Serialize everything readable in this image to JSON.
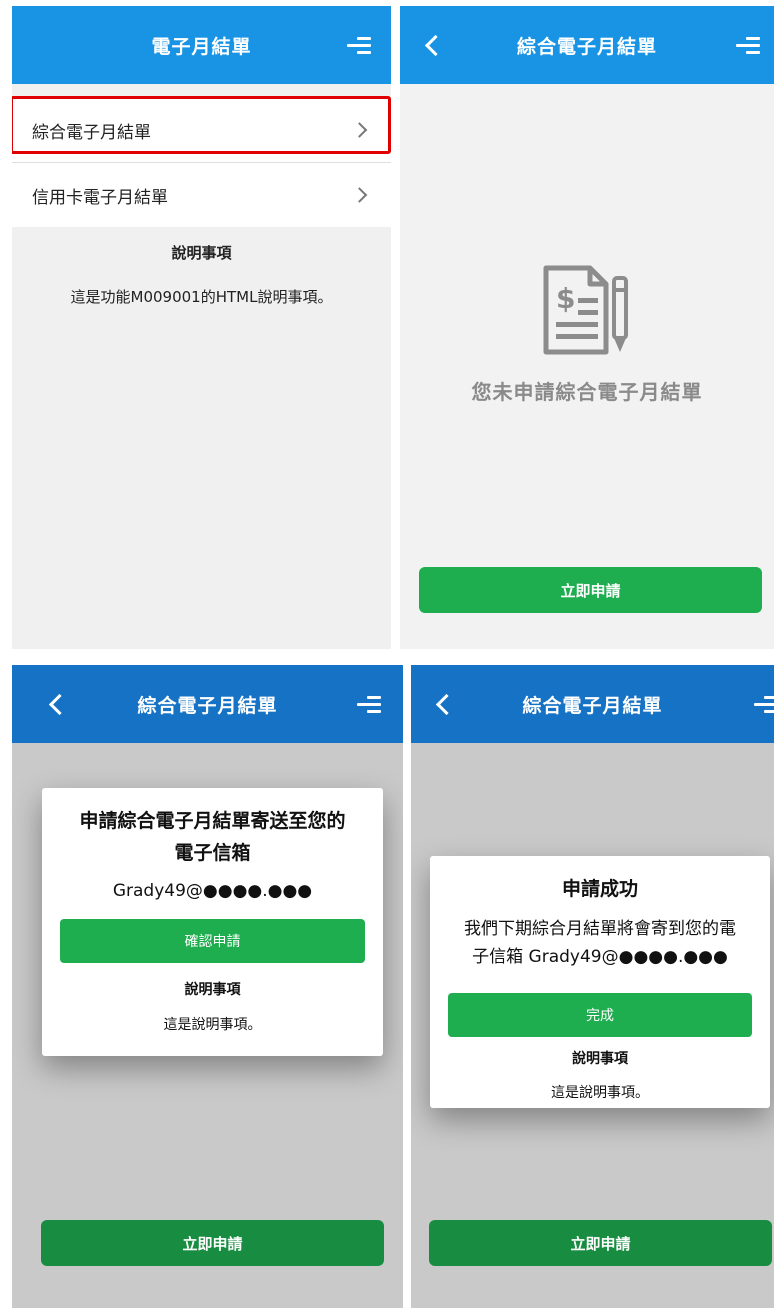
{
  "colors": {
    "header_blue": "#1994e5",
    "header_blue_dark": "#1672c4",
    "green": "#1fae4f",
    "green_dark": "#188c40",
    "highlight_red": "#e00000",
    "overlay_gray": "#c9c9c9"
  },
  "screen1": {
    "header": {
      "title": "電子月結單",
      "menu_icon": "menu-icon"
    },
    "items": [
      {
        "label": "綜合電子月結單",
        "icon": "chevron-right-icon",
        "highlighted": true
      },
      {
        "label": "信用卡電子月結單",
        "icon": "chevron-right-icon",
        "highlighted": false
      }
    ],
    "notes": {
      "title": "說明事項",
      "text": "這是功能M009001的HTML說明事項。"
    }
  },
  "screen2": {
    "header": {
      "title": "綜合電子月結單",
      "back_icon": "back-arrow-icon",
      "menu_icon": "menu-icon"
    },
    "empty_icon": "bill-document-pen-icon",
    "empty_message": "您未申請綜合電子月結單",
    "apply_button": "立即申請"
  },
  "screen3": {
    "header": {
      "title": "綜合電子月結單"
    },
    "modal": {
      "title_line1": "申請綜合電子月結單寄送至您的",
      "title_line2": "電子信箱",
      "email": "Grady49@●●●●.●●●",
      "confirm_button": "確認申請",
      "notes_title": "說明事項",
      "notes_text": "這是說明事項。"
    },
    "apply_button": "立即申請"
  },
  "screen4": {
    "header": {
      "title": "綜合電子月結單"
    },
    "modal": {
      "title": "申請成功",
      "message_line1": "我們下期綜合月結單將會寄到您的電",
      "message_line2": "子信箱 Grady49@●●●●.●●●",
      "done_button": "完成",
      "notes_title": "說明事項",
      "notes_text": "這是說明事項。"
    },
    "apply_button": "立即申請"
  }
}
